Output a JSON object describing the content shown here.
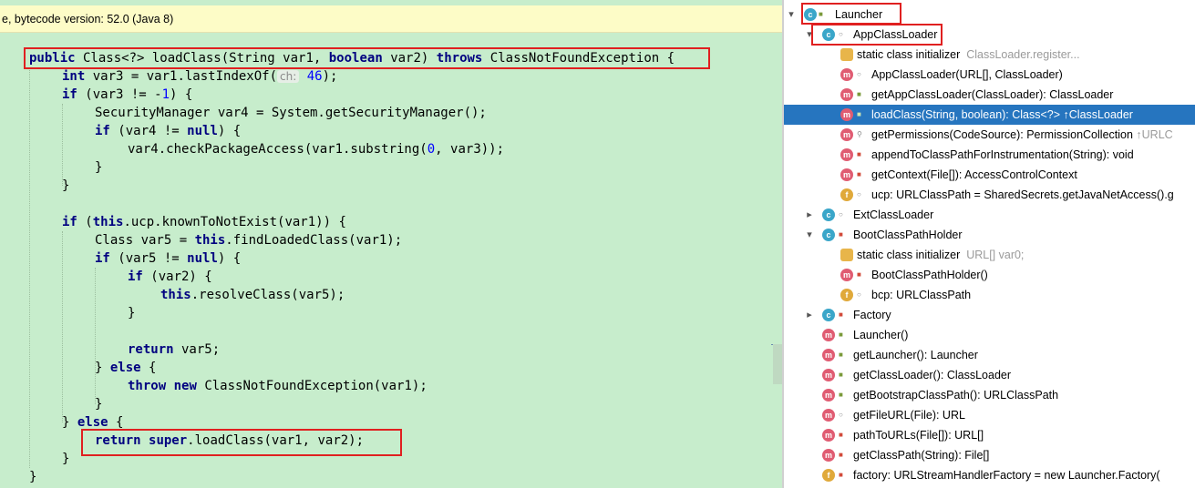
{
  "notice": {
    "text": "e, bytecode version: 52.0 (Java 8)"
  },
  "code": {
    "l1_kw_public": "public",
    "l1_type": " Class<?> ",
    "l1_method": "loadClass",
    "l1_params_a": "(String var1, ",
    "l1_kw_boolean": "boolean",
    "l1_params_b": " var2) ",
    "l1_kw_throws": "throws",
    "l1_exc": " ClassNotFoundException",
    "l1_brace": " {",
    "l2_kw_int": "int",
    "l2_a": " var3 = var1.lastIndexOf(",
    "l2_hint": "ch:",
    "l2_num": "46",
    "l2_b": ");",
    "l3_kw_if": "if",
    "l3_a": " (var3 != -",
    "l3_num": "1",
    "l3_b": ") {",
    "l4": "SecurityManager var4 = System.getSecurityManager();",
    "l5_kw_if": "if",
    "l5_a": " (var4 != ",
    "l5_kw_null": "null",
    "l5_b": ") {",
    "l6_a": "var4.checkPackageAccess(var1.substring(",
    "l6_num": "0",
    "l6_b": ", var3));",
    "close_brace": "}",
    "l10_kw_if": "if",
    "l10_a": " (",
    "l10_kw_this": "this",
    "l10_b": ".ucp.knownToNotExist(var1)) {",
    "l11_a": "Class var5 = ",
    "l11_kw_this": "this",
    "l11_b": ".findLoadedClass(var1);",
    "l12_kw_if": "if",
    "l12_a": " (var5 != ",
    "l12_kw_null": "null",
    "l12_b": ") {",
    "l13_kw_if": "if",
    "l13_a": " (var2) {",
    "l14_kw_this": "this",
    "l14_a": ".resolveClass(var5);",
    "l17_kw_return": "return",
    "l17_a": " var5;",
    "l18_a": "} ",
    "l18_kw_else": "else",
    "l18_b": " {",
    "l19_kw_throw": "throw",
    "l19_kw_new": "new",
    "l19_a": " ClassNotFoundException(var1);",
    "l21_a": "} ",
    "l21_kw_else": "else",
    "l21_b": " {",
    "l22_kw_return": "return",
    "l22_kw_super": "super",
    "l22_method": "loadClass",
    "l22_a": "(var1, var2);"
  },
  "tree": {
    "launcher": "Launcher",
    "appclassloader": "AppClassLoader",
    "static_init": "static class initializer",
    "static_init_hint": "ClassLoader.register...",
    "ctor": "AppClassLoader(URL[], ClassLoader)",
    "getapp": "getAppClassLoader(ClassLoader): ClassLoader",
    "loadclass": "loadClass(String, boolean): Class<?> ↑ClassLoader",
    "getperms": "getPermissions(CodeSource): PermissionCollection",
    "getperms_hint": "↑URLC",
    "append": "appendToClassPathForInstrumentation(String): void",
    "getcontext": "getContext(File[]): AccessControlContext",
    "ucp": "ucp: URLClassPath = SharedSecrets.getJavaNetAccess().g",
    "ext": "ExtClassLoader",
    "boot": "BootClassPathHolder",
    "boot_static": "static class initializer",
    "boot_static_hint": "URL[] var0;",
    "boot_ctor": "BootClassPathHolder()",
    "bcp": "bcp: URLClassPath",
    "factory": "Factory",
    "launcher_ctor": "Launcher()",
    "getlauncher": "getLauncher(): Launcher",
    "getcl": "getClassLoader(): ClassLoader",
    "getboot": "getBootstrapClassPath(): URLClassPath",
    "getfileurl": "getFileURL(File): URL",
    "pathtourls": "pathToURLs(File[]): URL[]",
    "getcp": "getClassPath(String): File[]",
    "factoryfield": "factory: URLStreamHandlerFactory = new Launcher.Factory("
  },
  "icons": {
    "class": "c",
    "method": "m",
    "field": "f"
  },
  "colors": {
    "editor_bg": "#c7edcc",
    "keyword": "#000080",
    "number": "#0000ff",
    "selection": "#2675bf",
    "highlight_box": "#e02020"
  }
}
